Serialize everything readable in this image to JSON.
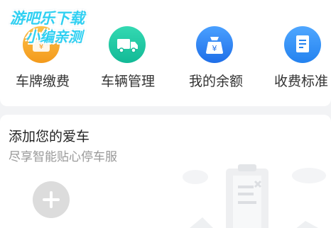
{
  "watermark": {
    "line1": "游吧乐下载",
    "line2": "小编亲测"
  },
  "quick_actions": [
    {
      "label": "车牌缴费",
      "icon": "wallet-yen-icon",
      "color": "#f5a623"
    },
    {
      "label": "车辆管理",
      "icon": "truck-icon",
      "color": "#1ec8a5"
    },
    {
      "label": "我的余额",
      "icon": "yen-bag-icon",
      "color": "#2f7ff2"
    },
    {
      "label": "收费标准",
      "icon": "document-icon",
      "color": "#2f8ff2"
    }
  ],
  "car_card": {
    "title": "添加您的爱车",
    "subtitle": "尽享智能贴心停车服"
  }
}
